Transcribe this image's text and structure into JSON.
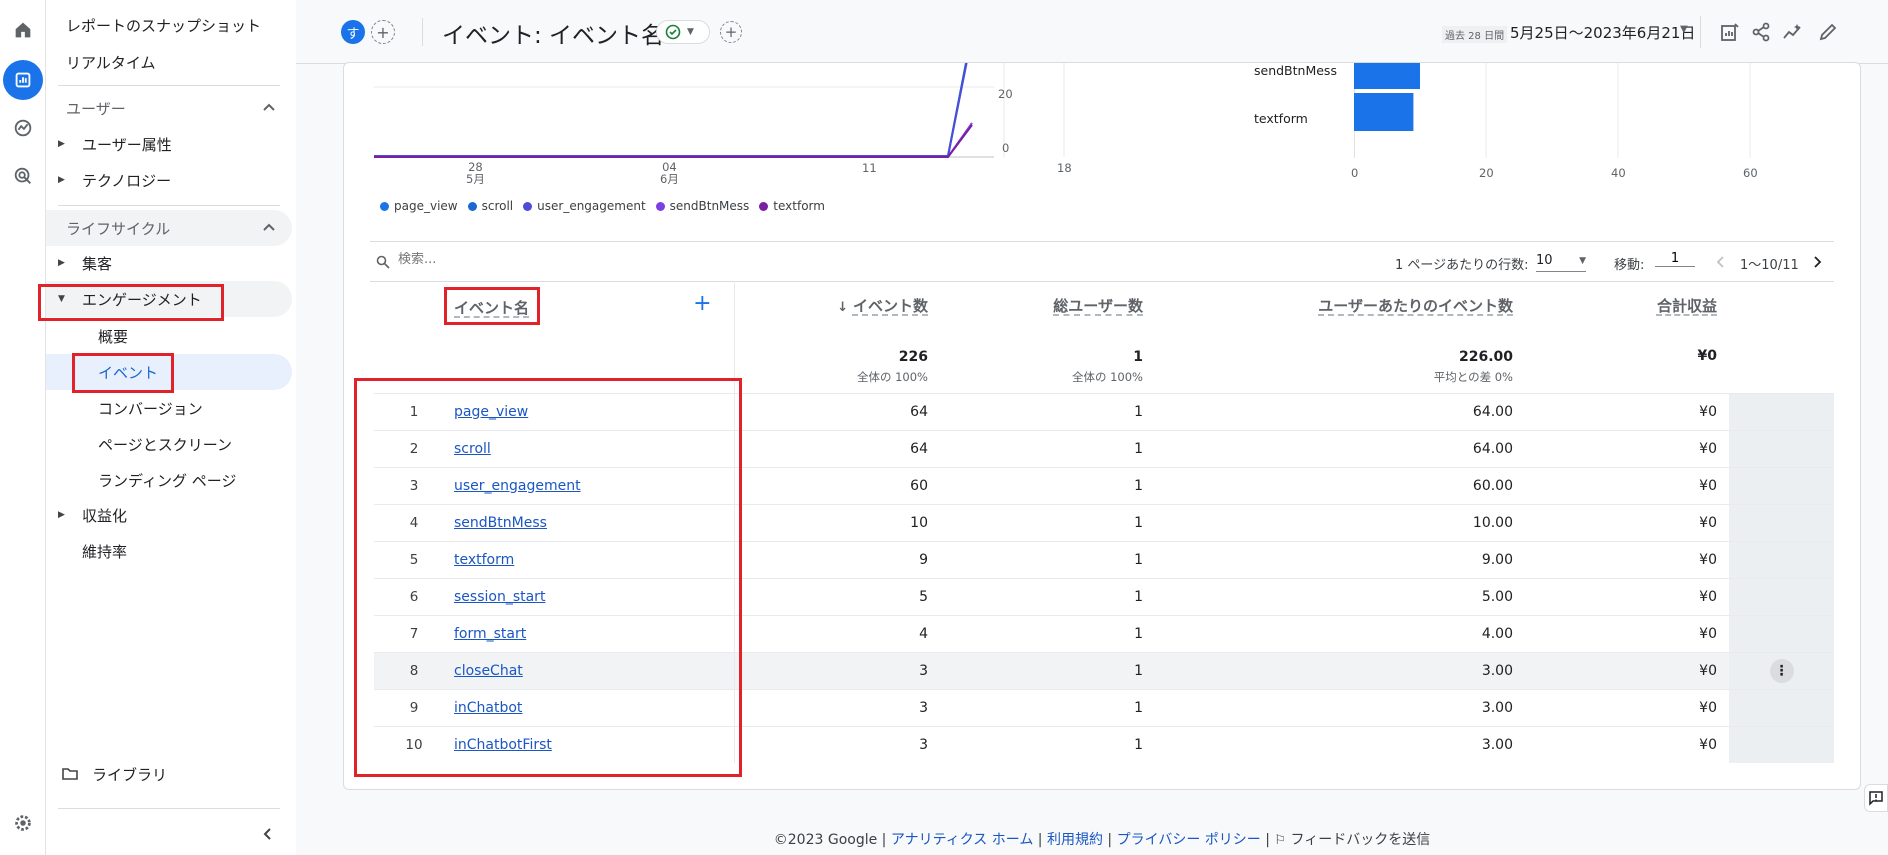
{
  "nav": {
    "snapshot": "レポートのスナップショット",
    "realtime": "リアルタイム",
    "user_section": "ユーザー",
    "user_attr": "ユーザー属性",
    "technology": "テクノロジー",
    "lifecycle_section": "ライフサイクル",
    "acquisition": "集客",
    "engagement": "エンゲージメント",
    "overview": "概要",
    "events": "イベント",
    "conversions": "コンバージョン",
    "pages": "ページとスクリーン",
    "landing": "ランディング ページ",
    "monetization": "収益化",
    "retention": "維持率",
    "library": "ライブラリ"
  },
  "header": {
    "avatar_letter": "す",
    "title": "イベント: イベント名",
    "date_prefix": "過去 28 日間",
    "date_range": "5月25日～2023年6月21日"
  },
  "line_chart": {
    "x_ticks": [
      {
        "day": "28",
        "month": "5月"
      },
      {
        "day": "04",
        "month": "6月"
      },
      {
        "day": "11",
        "month": ""
      },
      {
        "day": "18",
        "month": ""
      }
    ],
    "y_ticks": [
      "20",
      "0"
    ]
  },
  "bar_chart": {
    "labels": [
      "sendBtnMess",
      "textform"
    ],
    "values": [
      10,
      9
    ],
    "x_ticks": [
      "0",
      "20",
      "40",
      "60"
    ],
    "xlim": [
      0,
      60
    ]
  },
  "legend": [
    {
      "name": "page_view",
      "color": "#1a73e8"
    },
    {
      "name": "scroll",
      "color": "#1967d2"
    },
    {
      "name": "user_engagement",
      "color": "#4e4cd6"
    },
    {
      "name": "sendBtnMess",
      "color": "#7b3fe4"
    },
    {
      "name": "textform",
      "color": "#7b1fa2"
    }
  ],
  "toolbar": {
    "search_placeholder": "検索...",
    "rows_label": "1 ページあたりの行数:",
    "rows_value": "10",
    "goto_label": "移動:",
    "goto_value": "1",
    "pagination": "1～10/11"
  },
  "table": {
    "headers": {
      "event_name": "イベント名",
      "event_count": "イベント数",
      "total_users": "総ユーザー数",
      "per_user": "ユーザーあたりのイベント数",
      "revenue": "合計収益"
    },
    "totals": {
      "event_count": "226",
      "event_count_sub": "全体の 100%",
      "total_users": "1",
      "total_users_sub": "全体の 100%",
      "per_user": "226.00",
      "per_user_sub": "平均との差 0%",
      "revenue": "¥0"
    },
    "rows": [
      {
        "idx": "1",
        "name": "page_view",
        "count": "64",
        "users": "1",
        "per_user": "64.00",
        "revenue": "¥0"
      },
      {
        "idx": "2",
        "name": "scroll",
        "count": "64",
        "users": "1",
        "per_user": "64.00",
        "revenue": "¥0"
      },
      {
        "idx": "3",
        "name": "user_engagement",
        "count": "60",
        "users": "1",
        "per_user": "60.00",
        "revenue": "¥0"
      },
      {
        "idx": "4",
        "name": "sendBtnMess",
        "count": "10",
        "users": "1",
        "per_user": "10.00",
        "revenue": "¥0"
      },
      {
        "idx": "5",
        "name": "textform",
        "count": "9",
        "users": "1",
        "per_user": "9.00",
        "revenue": "¥0"
      },
      {
        "idx": "6",
        "name": "session_start",
        "count": "5",
        "users": "1",
        "per_user": "5.00",
        "revenue": "¥0"
      },
      {
        "idx": "7",
        "name": "form_start",
        "count": "4",
        "users": "1",
        "per_user": "4.00",
        "revenue": "¥0"
      },
      {
        "idx": "8",
        "name": "closeChat",
        "count": "3",
        "users": "1",
        "per_user": "3.00",
        "revenue": "¥0"
      },
      {
        "idx": "9",
        "name": "inChatbot",
        "count": "3",
        "users": "1",
        "per_user": "3.00",
        "revenue": "¥0"
      },
      {
        "idx": "10",
        "name": "inChatbotFirst",
        "count": "3",
        "users": "1",
        "per_user": "3.00",
        "revenue": "¥0"
      }
    ]
  },
  "footer": {
    "copyright": "©2023 Google |",
    "analytics_home": "アナリティクス ホーム",
    "sep1": "|",
    "terms": "利用規約",
    "sep2": "|",
    "privacy": "プライバシー ポリシー",
    "sep3": "|",
    "feedback": "フィードバックを送信"
  }
}
